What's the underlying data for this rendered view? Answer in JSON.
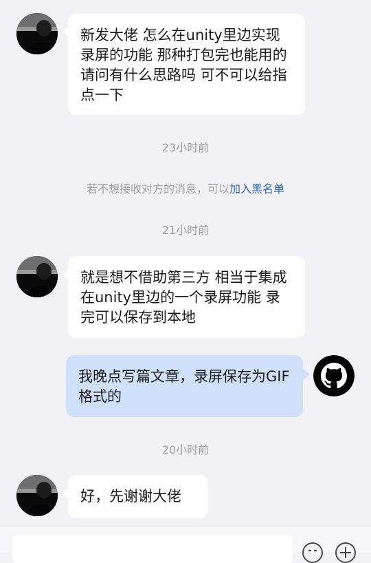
{
  "messages": [
    {
      "side": "left",
      "text": "新发大佬 怎么在unity里边实现录屏的功能 那种打包完也能用的 请问有什么思路吗 可不可以给指点一下"
    },
    {
      "side": "left",
      "text": "就是想不借助第三方 相当于集成在unity里边的一个录屏功能 录完可以保存到本地"
    },
    {
      "side": "right",
      "text": "我晚点写篇文章，录屏保存为GIF格式的"
    },
    {
      "side": "left",
      "text": "好，先谢谢大佬"
    }
  ],
  "timestamps": [
    "23小时前",
    "21小时前",
    "20小时前"
  ],
  "notice": {
    "text": "若不想接收对方的消息，可以",
    "link": "加入黑名单"
  },
  "icons": {
    "other_avatar": "user-avatar-photo",
    "self_avatar": "github-octocat-avatar",
    "emoji": "emoji-icon",
    "plus": "plus-icon"
  },
  "colors": {
    "link": "#2a64c8",
    "own_bubble": "#cfe0fb"
  }
}
